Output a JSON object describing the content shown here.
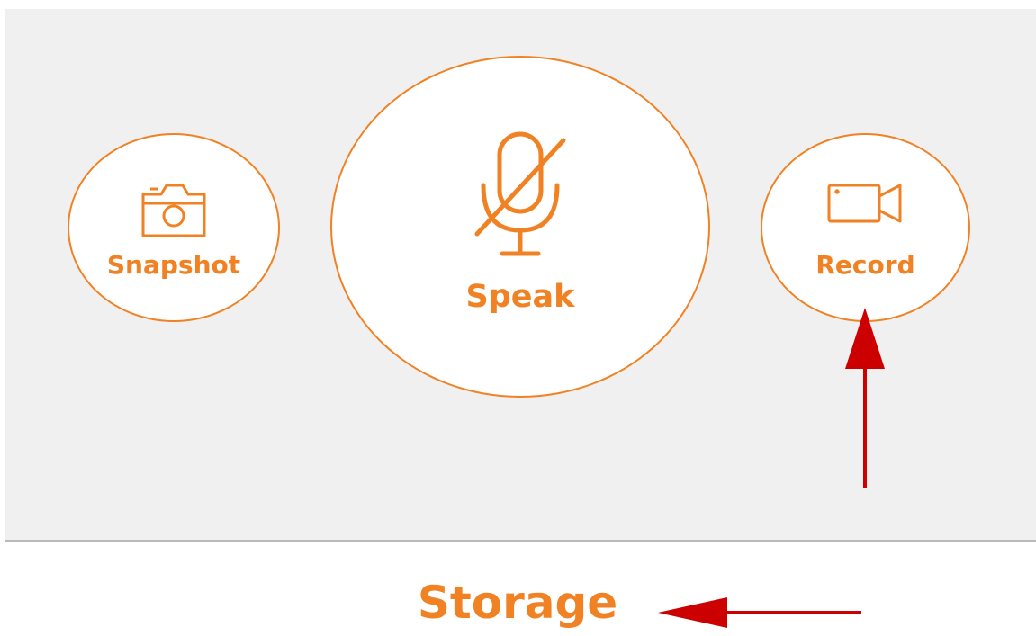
{
  "controls": {
    "snapshot": {
      "label": "Snapshot",
      "icon": "camera-icon"
    },
    "speak": {
      "label": "Speak",
      "icon": "microphone-muted-icon"
    },
    "record": {
      "label": "Record",
      "icon": "video-camera-icon"
    }
  },
  "storage": {
    "label": "Storage"
  },
  "annotations": [
    {
      "name": "arrow-to-record",
      "direction": "up",
      "color": "#cc0000"
    },
    {
      "name": "arrow-to-storage",
      "direction": "left",
      "color": "#cc0000"
    }
  ],
  "colors": {
    "accent": "#f08224",
    "panel_background": "#f1f0f1",
    "annotation": "#cc0000"
  }
}
